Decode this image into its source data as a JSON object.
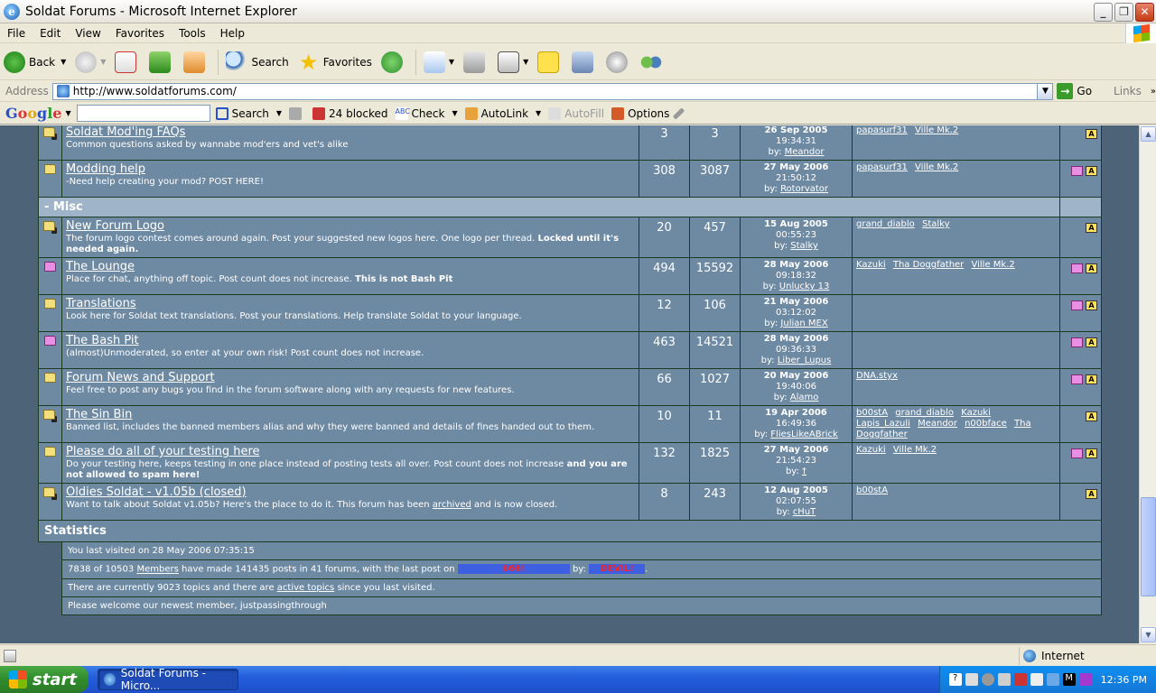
{
  "window": {
    "title": "Soldat Forums - Microsoft Internet Explorer",
    "app_icon": "ie-icon"
  },
  "menu": [
    "File",
    "Edit",
    "View",
    "Favorites",
    "Tools",
    "Help"
  ],
  "toolbar": {
    "back": "Back",
    "search": "Search",
    "favorites": "Favorites"
  },
  "address": {
    "label": "Address",
    "url": "http://www.soldatforums.com/",
    "go": "Go",
    "links": "Links"
  },
  "google": {
    "search": "Search",
    "blocked": "24 blocked",
    "check": "Check",
    "autolink": "AutoLink",
    "autofill": "AutoFill",
    "options": "Options"
  },
  "forums_top": [
    {
      "name": "Soldat Mod'ing FAQs",
      "desc": "Common questions asked by wannabe mod'ers and vet's alike",
      "topics": "3",
      "posts": "3",
      "date": "26 Sep 2005",
      "time": "19:34:31",
      "by": "by:",
      "user": "Meandor",
      "mods": [
        "papasurf31",
        "Ville Mk.2"
      ],
      "icon": "folder-locked",
      "flags": [
        "a"
      ]
    },
    {
      "name": "Modding help",
      "desc": "-Need help creating your mod? POST HERE!",
      "topics": "308",
      "posts": "3087",
      "date": "27 May 2006",
      "time": "21:50:12",
      "by": "by:",
      "user": "Rotorvator",
      "mods": [
        "papasurf31",
        "Ville Mk.2"
      ],
      "icon": "folder",
      "flags": [
        "p",
        "a"
      ]
    }
  ],
  "section": {
    "label": "- Misc"
  },
  "forums_misc": [
    {
      "name": "New Forum Logo",
      "desc": "The forum logo contest comes around again. Post your suggested new logos here. One logo per thread.",
      "desc_bold": "Locked until it's needed again.",
      "topics": "20",
      "posts": "457",
      "date": "15 Aug 2005",
      "time": "00:55:23",
      "by": "by:",
      "user": "Stalky",
      "mods": [
        "grand_diablo",
        "Stalky"
      ],
      "icon": "folder-locked",
      "flags": [
        "a"
      ]
    },
    {
      "name": "The Lounge",
      "desc": "Place for chat, anything off topic. Post count does not increase.",
      "desc_bold": "This is not Bash Pit",
      "topics": "494",
      "posts": "15592",
      "date": "28 May 2006",
      "time": "09:18:32",
      "by": "by:",
      "user": "Unlucky 13",
      "mods": [
        "Kazuki",
        "Tha Doggfather",
        "Ville Mk.2"
      ],
      "icon": "folder-pink",
      "flags": [
        "p",
        "a"
      ]
    },
    {
      "name": "Translations",
      "desc": "Look here for Soldat text translations. Post your translations. Help translate Soldat to your language.",
      "desc_bold": "",
      "topics": "12",
      "posts": "106",
      "date": "21 May 2006",
      "time": "03:12:02",
      "by": "by:",
      "user": "Julian MEX",
      "mods": [],
      "icon": "folder",
      "flags": [
        "p",
        "a"
      ]
    },
    {
      "name": "The Bash Pit",
      "desc": "(almost)Unmoderated, so enter at your own risk! Post count does not increase.",
      "desc_bold": "",
      "topics": "463",
      "posts": "14521",
      "date": "28 May 2006",
      "time": "09:36:33",
      "by": "by:",
      "user": "Liber_Lupus",
      "mods": [],
      "icon": "folder-pink",
      "flags": [
        "p",
        "a"
      ]
    },
    {
      "name": "Forum News and Support",
      "desc": "Feel free to post any bugs you find in the forum software along with any requests for new features.",
      "desc_bold": "",
      "topics": "66",
      "posts": "1027",
      "date": "20 May 2006",
      "time": "19:40:06",
      "by": "by:",
      "user": "Alamo",
      "mods": [
        "DNA.styx"
      ],
      "icon": "folder",
      "flags": [
        "p",
        "a"
      ]
    },
    {
      "name": "The Sin Bin",
      "desc": "Banned list, includes the banned members alias and why they were banned and details of fines handed out to them.",
      "desc_bold": "",
      "topics": "10",
      "posts": "11",
      "date": "19 Apr 2006",
      "time": "16:49:36",
      "by": "by:",
      "user": "FliesLikeABrick",
      "mods": [
        "b00stA",
        "grand_diablo",
        "Kazuki",
        "Lapis_Lazuli",
        "Meandor",
        "n00bface",
        "Tha Doggfather"
      ],
      "icon": "folder-locked",
      "flags": [
        "a"
      ]
    },
    {
      "name": "Please do all of your testing here",
      "desc": "Do your testing here, keeps testing in one place instead of posting tests all over. Post count does not increase",
      "desc_bold": "and you are not allowed to spam here!",
      "topics": "132",
      "posts": "1825",
      "date": "27 May 2006",
      "time": "21:54:23",
      "by": "by:",
      "user": "†",
      "mods": [
        "Kazuki",
        "Ville Mk.2"
      ],
      "icon": "folder",
      "flags": [
        "p",
        "a"
      ]
    },
    {
      "name": "Oldies Soldat - v1.05b (closed)",
      "desc": "Want to talk about Soldat v1.05b? Here's the place to do it. This forum has been",
      "desc_link": "archived",
      "desc_tail": "and is now closed.",
      "topics": "8",
      "posts": "243",
      "date": "12 Aug 2005",
      "time": "02:07:55",
      "by": "by:",
      "user": "cHuT",
      "mods": [
        "b00stA"
      ],
      "icon": "folder-locked",
      "flags": [
        "a"
      ]
    }
  ],
  "stats": {
    "heading": "Statistics",
    "line1": "You last visited on 28 May 2006 07:35:15",
    "line2_a": "7838 of 10503",
    "line2_members": "Members",
    "line2_b": "have made 141435 posts in 41 forums, with the last post on",
    "line2_bar1": "666!",
    "line2_by": "by:",
    "line2_bar2": "DEVIL!",
    "line3_a": "There are currently 9023 topics and there are",
    "line3_link": "active topics",
    "line3_b": "since you last visited.",
    "line4": "Please welcome our newest member, justpassingthrough"
  },
  "status": {
    "zone": "Internet"
  },
  "taskbar": {
    "start": "start",
    "task": "Soldat Forums - Micro...",
    "clock": "12:36 PM"
  }
}
